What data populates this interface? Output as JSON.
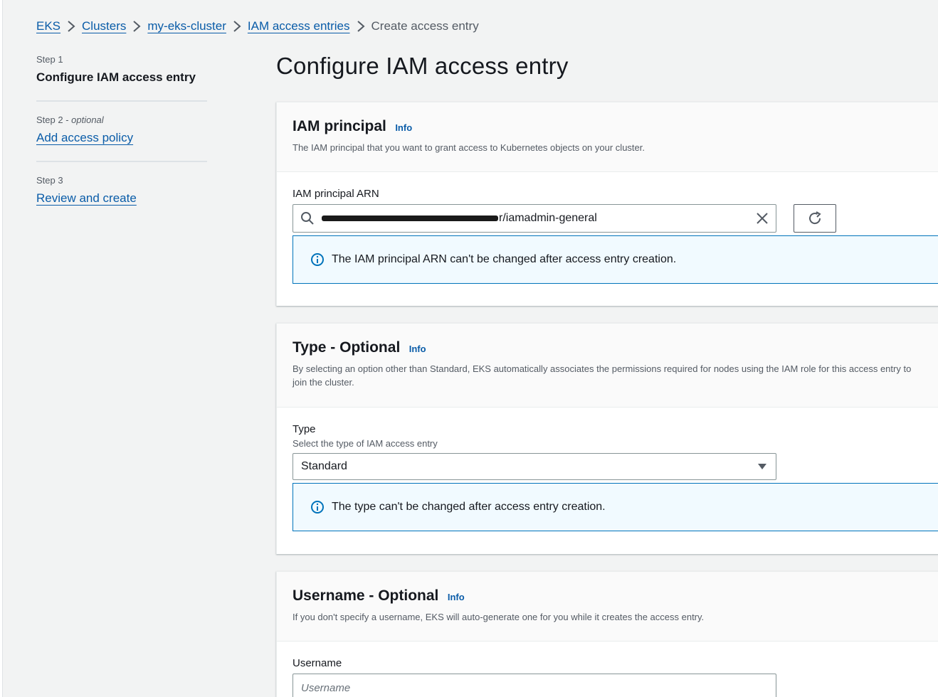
{
  "breadcrumb": {
    "items": [
      "EKS",
      "Clusters",
      "my-eks-cluster",
      "IAM access entries"
    ],
    "current": "Create access entry"
  },
  "steps": [
    {
      "label": "Step 1",
      "suffix": "",
      "title": "Configure IAM access entry"
    },
    {
      "label": "Step 2 - ",
      "suffix": "optional",
      "title": "Add access policy"
    },
    {
      "label": "Step 3",
      "suffix": "",
      "title": "Review and create"
    }
  ],
  "page": {
    "title": "Configure IAM access entry"
  },
  "iam_principal": {
    "title": "IAM principal",
    "info": "Info",
    "description": "The IAM principal that you want to grant access to Kubernetes objects on your cluster.",
    "field_label": "IAM principal ARN",
    "value_suffix": "r/iamadmin-general",
    "alert": "The IAM principal ARN can't be changed after access entry creation."
  },
  "type_section": {
    "title": "Type - Optional",
    "info": "Info",
    "description": "By selecting an option other than Standard, EKS automatically associates the permissions required for nodes using the IAM role for this access entry to join the cluster.",
    "field_label": "Type",
    "field_desc": "Select the type of IAM access entry",
    "selected": "Standard",
    "alert": "The type can't be changed after access entry creation."
  },
  "username_section": {
    "title": "Username - Optional",
    "info": "Info",
    "description": "If you don't specify a username, EKS will auto-generate one for you while it creates the access entry.",
    "field_label": "Username",
    "placeholder": "Username"
  },
  "colors": {
    "link": "#0a5ca8",
    "info_border": "#0073bb",
    "info_bg": "#f1faff"
  }
}
